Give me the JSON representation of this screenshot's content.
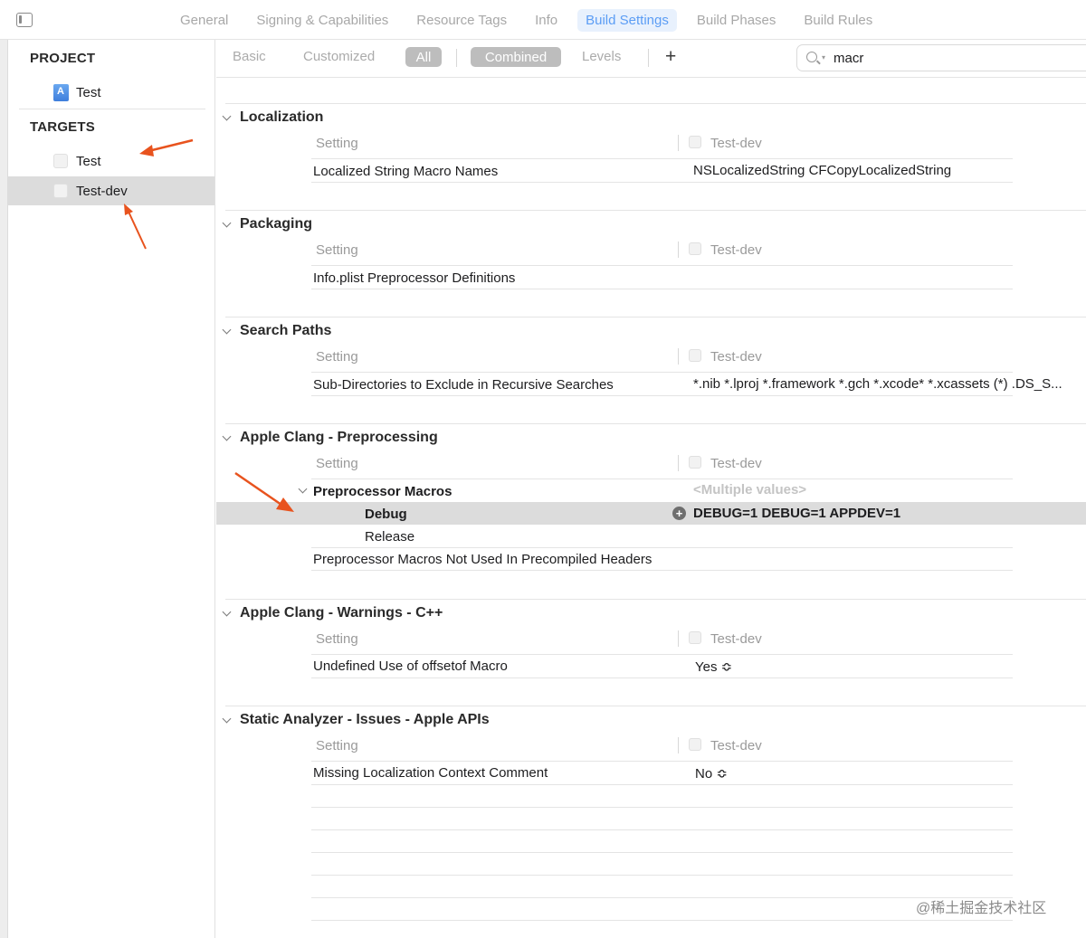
{
  "tabs": [
    "General",
    "Signing & Capabilities",
    "Resource Tags",
    "Info",
    "Build Settings",
    "Build Phases",
    "Build Rules"
  ],
  "active_tab": "Build Settings",
  "sidebar": {
    "project_header": "PROJECT",
    "project_item": "Test",
    "targets_header": "TARGETS",
    "targets": [
      "Test",
      "Test-dev"
    ],
    "selected_target": "Test-dev"
  },
  "filters": {
    "basic": "Basic",
    "customized": "Customized",
    "all": "All",
    "combined": "Combined",
    "levels": "Levels",
    "add": "+"
  },
  "search": {
    "value": "macr"
  },
  "column_header": {
    "setting": "Setting",
    "target": "Test-dev"
  },
  "groups": [
    {
      "title": "Localization",
      "rows": [
        {
          "setting": "Localized String Macro Names",
          "value": "NSLocalizedString CFCopyLocalizedString"
        }
      ]
    },
    {
      "title": "Packaging",
      "rows": [
        {
          "setting": "Info.plist Preprocessor Definitions",
          "value": ""
        }
      ]
    },
    {
      "title": "Search Paths",
      "rows": [
        {
          "setting": "Sub-Directories to Exclude in Recursive Searches",
          "value": "*.nib *.lproj *.framework *.gch *.xcode* *.xcassets (*) .DS_S..."
        }
      ]
    },
    {
      "title": "Apple Clang - Preprocessing",
      "rows": [
        {
          "setting": "Preprocessor Macros",
          "value": "<Multiple values>"
        },
        {
          "setting": "Debug",
          "value": "DEBUG=1 DEBUG=1  APPDEV=1"
        },
        {
          "setting": "Release",
          "value": ""
        },
        {
          "setting": "Preprocessor Macros Not Used In Precompiled Headers",
          "value": ""
        }
      ]
    },
    {
      "title": "Apple Clang - Warnings - C++",
      "rows": [
        {
          "setting": "Undefined Use of offsetof Macro",
          "value": "Yes ≎"
        }
      ]
    },
    {
      "title": "Static Analyzer - Issues - Apple APIs",
      "rows": [
        {
          "setting": "Missing Localization Context Comment",
          "value": "No ≎"
        }
      ]
    }
  ],
  "add_badge": "+",
  "watermark": "@稀土掘金技术社区",
  "colors": {
    "accent": "#5b9df5",
    "annotation_arrow": "#e8531e",
    "selection": "#dcdcdc"
  }
}
